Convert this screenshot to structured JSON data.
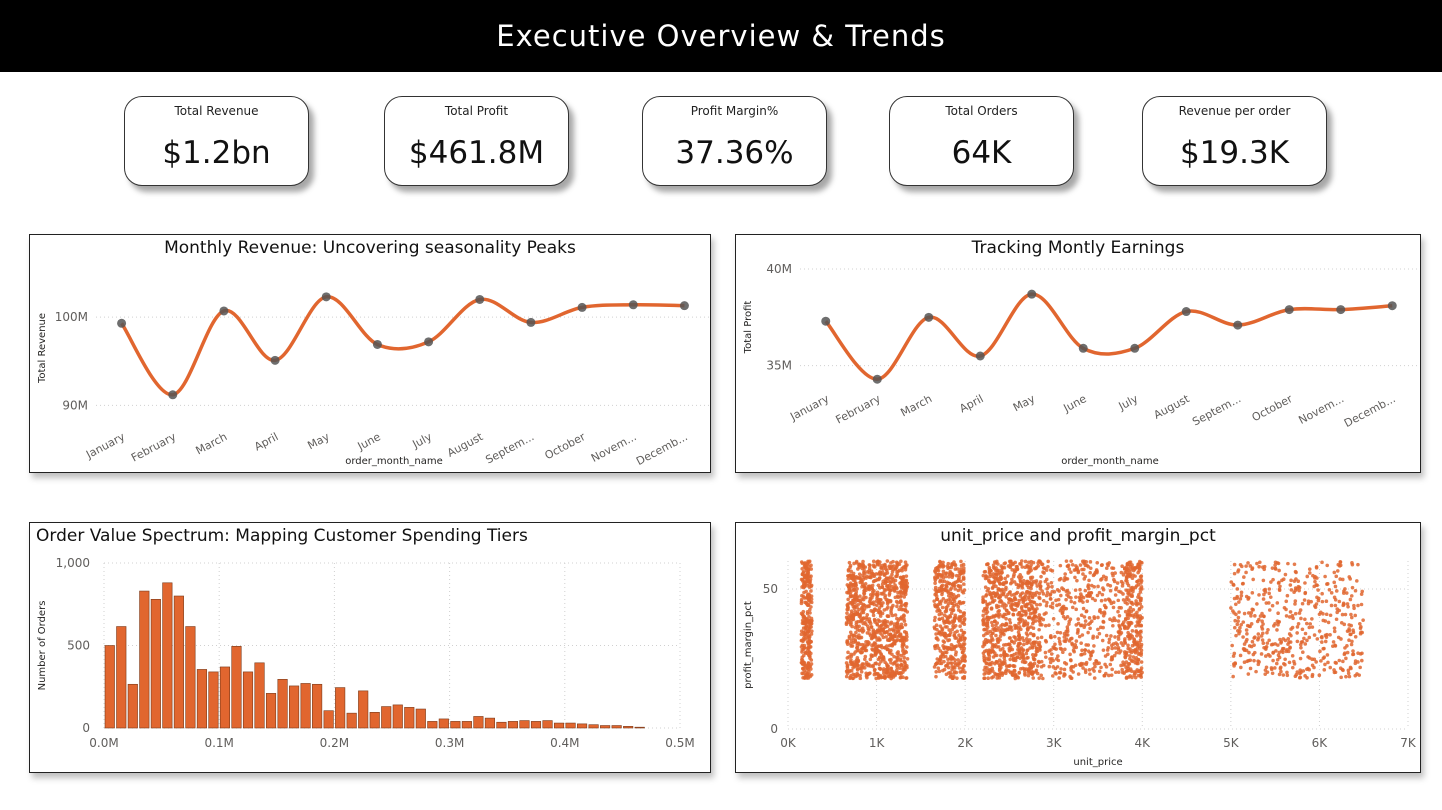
{
  "header": {
    "title": "Executive Overview & Trends"
  },
  "kpis": [
    {
      "label": "Total Revenue",
      "value": "$1.2bn"
    },
    {
      "label": "Total Profit",
      "value": "$461.8M"
    },
    {
      "label": "Profit Margin%",
      "value": "37.36%"
    },
    {
      "label": "Total Orders",
      "value": "64K"
    },
    {
      "label": "Revenue per order",
      "value": "$19.3K"
    }
  ],
  "colors": {
    "accent": "#E1662F",
    "marker": "#555555",
    "grid": "#d0d0d0"
  },
  "chart_data": [
    {
      "type": "line",
      "title": "Monthly Revenue: Uncovering seasonality Peaks",
      "xlabel": "order_month_name",
      "ylabel": "Total Revenue",
      "categories": [
        "January",
        "February",
        "March",
        "April",
        "May",
        "June",
        "July",
        "August",
        "Septem...",
        "October",
        "Novem...",
        "Decemb..."
      ],
      "values": [
        99.3,
        91.2,
        100.7,
        95.1,
        102.3,
        96.9,
        97.2,
        102.0,
        99.4,
        101.1,
        101.4,
        101.3
      ],
      "ylim": [
        88,
        105
      ],
      "yticks": [
        90,
        100
      ],
      "ytick_labels": [
        "90M",
        "100M"
      ],
      "grid": true
    },
    {
      "type": "line",
      "title": "Tracking Montly Earnings",
      "xlabel": "order_month_name",
      "ylabel": "Total Profit",
      "categories": [
        "January",
        "February",
        "March",
        "April",
        "May",
        "June",
        "July",
        "August",
        "Septem...",
        "October",
        "Novem...",
        "Decemb..."
      ],
      "values": [
        37.3,
        34.3,
        37.5,
        35.5,
        38.7,
        35.9,
        35.9,
        37.8,
        37.1,
        37.9,
        37.9,
        38.1
      ],
      "ylim": [
        34.0,
        40.0
      ],
      "yticks": [
        35,
        40
      ],
      "ytick_labels": [
        "35M",
        "40M"
      ],
      "grid": true
    },
    {
      "type": "bar",
      "title": "Order Value Spectrum: Mapping Customer Spending Tiers",
      "xlabel": "",
      "ylabel": "Number of Orders",
      "x": [
        0.005,
        0.015,
        0.025,
        0.035,
        0.045,
        0.055,
        0.065,
        0.075,
        0.085,
        0.095,
        0.105,
        0.115,
        0.125,
        0.135,
        0.145,
        0.155,
        0.165,
        0.175,
        0.185,
        0.195,
        0.205,
        0.215,
        0.225,
        0.235,
        0.245,
        0.255,
        0.265,
        0.275,
        0.285,
        0.295,
        0.305,
        0.315,
        0.325,
        0.335,
        0.345,
        0.355,
        0.365,
        0.375,
        0.385,
        0.395,
        0.405,
        0.415,
        0.425,
        0.435,
        0.445,
        0.455,
        0.465
      ],
      "values": [
        500,
        615,
        265,
        830,
        780,
        880,
        800,
        615,
        355,
        340,
        370,
        495,
        340,
        395,
        210,
        295,
        255,
        270,
        265,
        105,
        245,
        90,
        225,
        95,
        130,
        140,
        125,
        115,
        40,
        55,
        40,
        40,
        70,
        60,
        35,
        40,
        45,
        40,
        45,
        30,
        30,
        25,
        20,
        15,
        15,
        10,
        5
      ],
      "xlim": [
        0,
        0.5
      ],
      "ylim": [
        0,
        1000
      ],
      "xticks": [
        0,
        0.1,
        0.2,
        0.3,
        0.4,
        0.5
      ],
      "xtick_labels": [
        "0.0M",
        "0.1M",
        "0.2M",
        "0.3M",
        "0.4M",
        "0.5M"
      ],
      "yticks": [
        0,
        500,
        1000
      ],
      "ytick_labels": [
        "0",
        "500",
        "1,000"
      ],
      "grid": true
    },
    {
      "type": "scatter",
      "title": "unit_price and profit_margin_pct",
      "xlabel": "unit_price",
      "ylabel": "profit_margin_pct",
      "xlim": [
        0,
        7000
      ],
      "ylim": [
        0,
        60
      ],
      "xticks": [
        0,
        1000,
        2000,
        3000,
        4000,
        5000,
        6000,
        7000
      ],
      "xtick_labels": [
        "0K",
        "1K",
        "2K",
        "3K",
        "4K",
        "5K",
        "6K",
        "7K"
      ],
      "yticks": [
        0,
        50
      ],
      "ytick_labels": [
        "0",
        "50"
      ],
      "y_range_of_points": [
        18,
        60
      ],
      "clusters": [
        {
          "x_range": [
            150,
            270
          ],
          "count": 260
        },
        {
          "x_range": [
            660,
            1350
          ],
          "count": 950
        },
        {
          "x_range": [
            1650,
            2000
          ],
          "count": 420
        },
        {
          "x_range": [
            2200,
            2800
          ],
          "count": 700
        },
        {
          "x_range": [
            2800,
            3800
          ],
          "count": 500
        },
        {
          "x_range": [
            3800,
            4000
          ],
          "count": 260
        },
        {
          "x_range": [
            5000,
            6500
          ],
          "count": 500
        }
      ],
      "grid": true
    }
  ]
}
